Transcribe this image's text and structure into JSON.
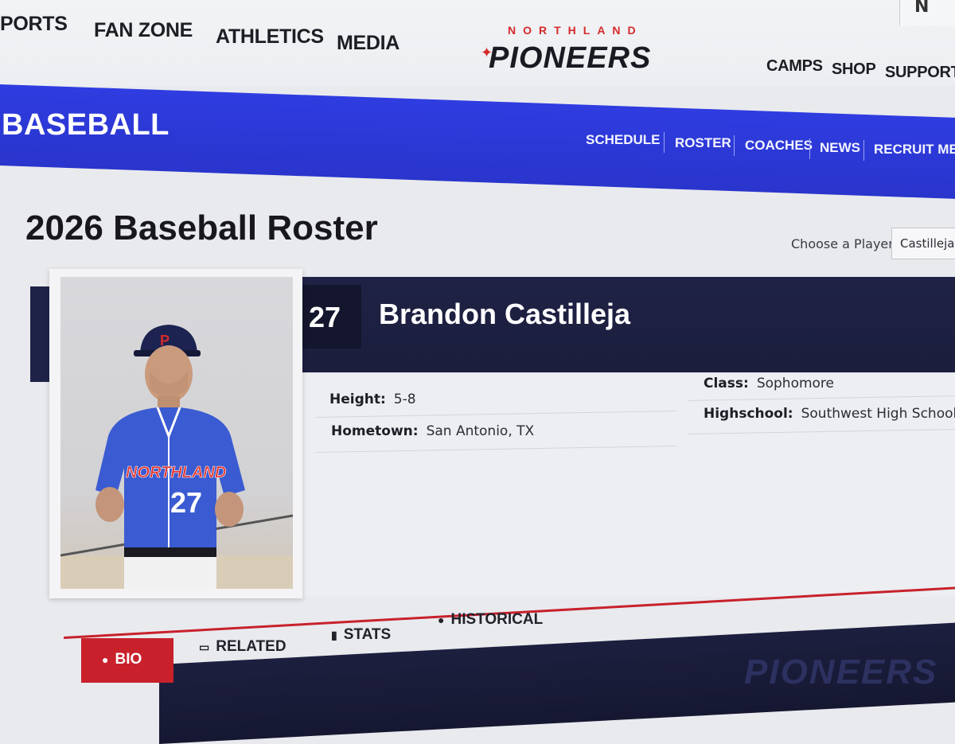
{
  "top_nav": {
    "left_items": [
      "PORTS",
      "FAN ZONE",
      "ATHLETICS",
      "MEDIA"
    ],
    "right_items": [
      "CAMPS",
      "SHOP",
      "SUPPORT"
    ],
    "corner_text": "N"
  },
  "logo": {
    "top_text": "NORTHLAND",
    "main_text": "PIONEERS"
  },
  "sport": {
    "title": "BASEBALL",
    "subnav": [
      "SCHEDULE",
      "ROSTER",
      "COACHES",
      "NEWS",
      "RECRUIT ME"
    ]
  },
  "page": {
    "title": "2026 Baseball Roster",
    "choose_label": "Choose a Player:",
    "choose_value": "Castilleja,"
  },
  "player": {
    "number": "27",
    "name": "Brandon Castilleja",
    "jersey_text": "NORTHLAND",
    "details": {
      "height_label": "Height:",
      "height": "5-8",
      "hometown_label": "Hometown:",
      "hometown": "San Antonio, TX",
      "class_label": "Class:",
      "class": "Sophomore",
      "highschool_label": "Highschool:",
      "highschool": "Southwest High School"
    }
  },
  "tabs": [
    {
      "label": "BIO",
      "icon": "speech-bubble-icon",
      "active": true
    },
    {
      "label": "RELATED",
      "icon": "stack-icon",
      "active": false
    },
    {
      "label": "STATS",
      "icon": "bar-chart-icon",
      "active": false
    },
    {
      "label": "HISTORICAL",
      "icon": "person-icon",
      "active": false
    }
  ],
  "footer": {
    "wordmark": "PIONEERS"
  },
  "colors": {
    "accent_red": "#c8212b",
    "brand_blue": "#2f3ce0",
    "navy": "#1e2246"
  }
}
